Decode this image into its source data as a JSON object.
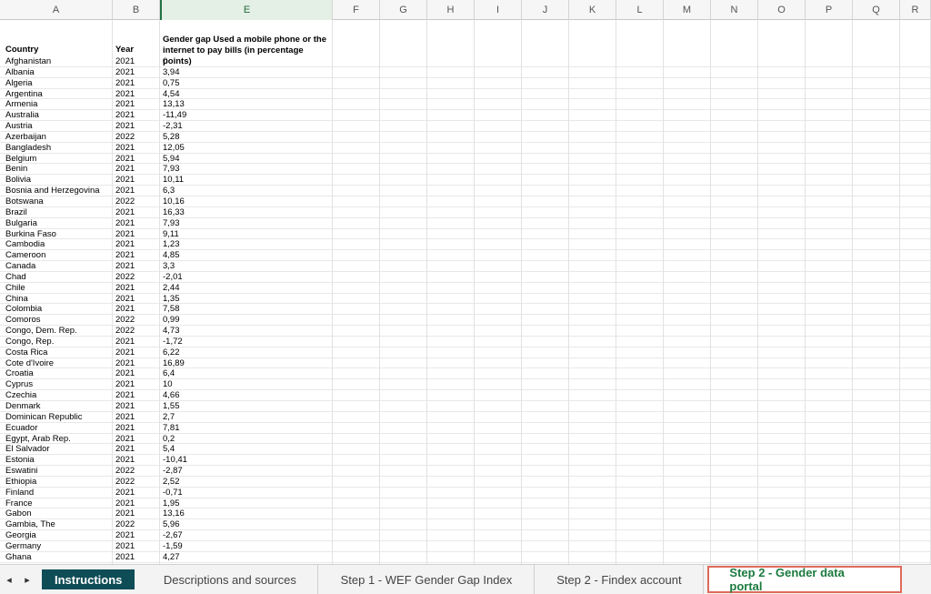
{
  "columns": [
    "A",
    "B",
    "E",
    "F",
    "G",
    "H",
    "I",
    "J",
    "K",
    "L",
    "M",
    "N",
    "O",
    "P",
    "Q",
    "R"
  ],
  "headers": {
    "country": "Country",
    "year": "Year",
    "gap": "Gender gap Used a mobile phone or the internet to pay bills (in percentage points)"
  },
  "rows": [
    [
      "Afghanistan",
      "2021",
      "0"
    ],
    [
      "Albania",
      "2021",
      "3,94"
    ],
    [
      "Algeria",
      "2021",
      "0,75"
    ],
    [
      "Argentina",
      "2021",
      "4,54"
    ],
    [
      "Armenia",
      "2021",
      "13,13"
    ],
    [
      "Australia",
      "2021",
      "-11,49"
    ],
    [
      "Austria",
      "2021",
      "-2,31"
    ],
    [
      "Azerbaijan",
      "2022",
      "5,28"
    ],
    [
      "Bangladesh",
      "2021",
      "12,05"
    ],
    [
      "Belgium",
      "2021",
      "5,94"
    ],
    [
      "Benin",
      "2021",
      "7,93"
    ],
    [
      "Bolivia",
      "2021",
      "10,11"
    ],
    [
      "Bosnia and Herzegovina",
      "2021",
      "6,3"
    ],
    [
      "Botswana",
      "2022",
      "10,16"
    ],
    [
      "Brazil",
      "2021",
      "16,33"
    ],
    [
      "Bulgaria",
      "2021",
      "7,93"
    ],
    [
      "Burkina Faso",
      "2021",
      "9,11"
    ],
    [
      "Cambodia",
      "2021",
      "1,23"
    ],
    [
      "Cameroon",
      "2021",
      "4,85"
    ],
    [
      "Canada",
      "2021",
      "3,3"
    ],
    [
      "Chad",
      "2022",
      "-2,01"
    ],
    [
      "Chile",
      "2021",
      "2,44"
    ],
    [
      "China",
      "2021",
      "1,35"
    ],
    [
      "Colombia",
      "2021",
      "7,58"
    ],
    [
      "Comoros",
      "2022",
      "0,99"
    ],
    [
      "Congo, Dem. Rep.",
      "2022",
      "4,73"
    ],
    [
      "Congo, Rep.",
      "2021",
      "-1,72"
    ],
    [
      "Costa Rica",
      "2021",
      "6,22"
    ],
    [
      "Cote d'Ivoire",
      "2021",
      "16,89"
    ],
    [
      "Croatia",
      "2021",
      "6,4"
    ],
    [
      "Cyprus",
      "2021",
      "10"
    ],
    [
      "Czechia",
      "2021",
      "4,66"
    ],
    [
      "Denmark",
      "2021",
      "1,55"
    ],
    [
      "Dominican Republic",
      "2021",
      "2,7"
    ],
    [
      "Ecuador",
      "2021",
      "7,81"
    ],
    [
      "Egypt, Arab Rep.",
      "2021",
      "0,2"
    ],
    [
      "El Salvador",
      "2021",
      "5,4"
    ],
    [
      "Estonia",
      "2021",
      "-10,41"
    ],
    [
      "Eswatini",
      "2022",
      "-2,87"
    ],
    [
      "Ethiopia",
      "2022",
      "2,52"
    ],
    [
      "Finland",
      "2021",
      "-0,71"
    ],
    [
      "France",
      "2021",
      "1,95"
    ],
    [
      "Gabon",
      "2021",
      "13,16"
    ],
    [
      "Gambia, The",
      "2022",
      "5,96"
    ],
    [
      "Georgia",
      "2021",
      "-2,67"
    ],
    [
      "Germany",
      "2021",
      "-1,59"
    ],
    [
      "Ghana",
      "2021",
      "4,27"
    ]
  ],
  "tabs": {
    "prev_icon": "◂",
    "next_icon": "▸",
    "instructions": "Instructions",
    "descriptions": "Descriptions and sources",
    "step1": "Step 1 - WEF Gender Gap Index",
    "step2_findex": "Step 2 - Findex account",
    "step2_portal": "Step 2 - Gender data portal"
  }
}
